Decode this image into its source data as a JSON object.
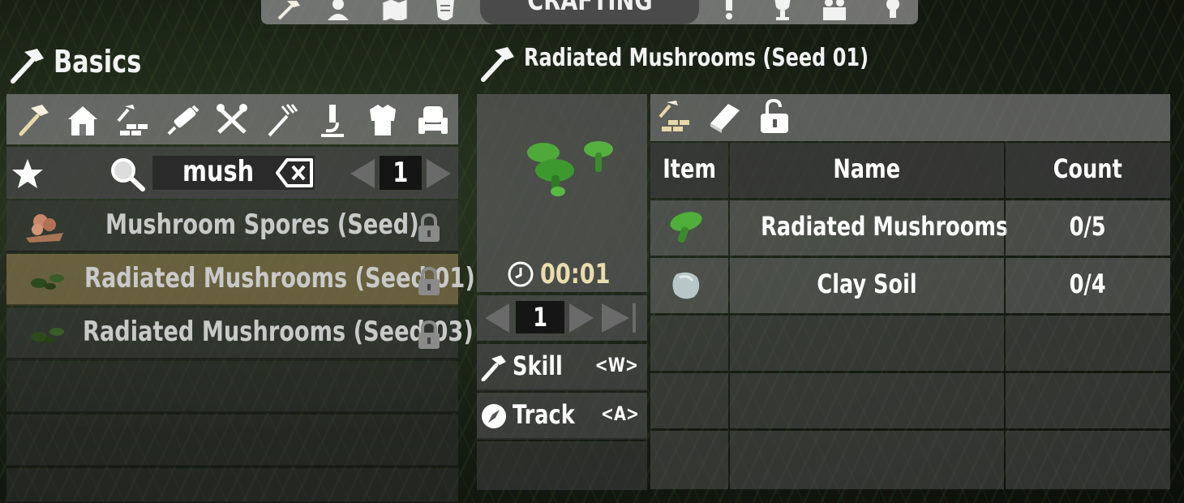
{
  "top_bar": {
    "title": "CRAFTING",
    "icons": [
      "hammer-icon",
      "character-icon",
      "map-icon",
      "quest-icon",
      "alert-icon",
      "trophy-icon",
      "players-icon",
      "lightbulb-icon"
    ]
  },
  "left_panel": {
    "heading": "Basics",
    "categories": [
      "hammer-icon",
      "house-icon",
      "building-icon",
      "medical-icon",
      "tools-icon",
      "fork-icon",
      "science-icon",
      "armor-icon",
      "furniture-icon"
    ],
    "search": {
      "favorite_icon": "star-icon",
      "value": "mush",
      "page": "1"
    },
    "recipes": [
      {
        "label": "Mushroom Spores (Seed)",
        "icon": "spores-icon",
        "locked": true,
        "selected": false
      },
      {
        "label": "Radiated Mushrooms (Seed 01)",
        "icon": "mushroom-seed-icon",
        "locked": true,
        "selected": true
      },
      {
        "label": "Radiated Mushrooms (Seed 03)",
        "icon": "mushroom-seed-icon",
        "locked": true,
        "selected": false
      }
    ]
  },
  "recipe_detail": {
    "heading": "Radiated Mushrooms (Seed 01)",
    "craft_time": "00:01",
    "quantity": "1",
    "actions": [
      {
        "label": "Skill",
        "key": "<W>",
        "icon": "hammer-icon"
      },
      {
        "label": "Track",
        "key": "<A>",
        "icon": "compass-icon"
      }
    ]
  },
  "ingredients": {
    "toolbar_icons": [
      "workbench-icon",
      "book-icon",
      "unlock-icon"
    ],
    "columns": [
      "Item",
      "Name",
      "Count"
    ],
    "rows": [
      {
        "name": "Radiated Mushrooms",
        "count": "0/5",
        "icon": "green-mushroom-icon"
      },
      {
        "name": "Clay Soil",
        "count": "0/4",
        "icon": "clay-icon"
      }
    ]
  },
  "colors": {
    "selected_row": "#82734b",
    "panel_dark": "#464646",
    "time_text": "#e9dcae"
  }
}
